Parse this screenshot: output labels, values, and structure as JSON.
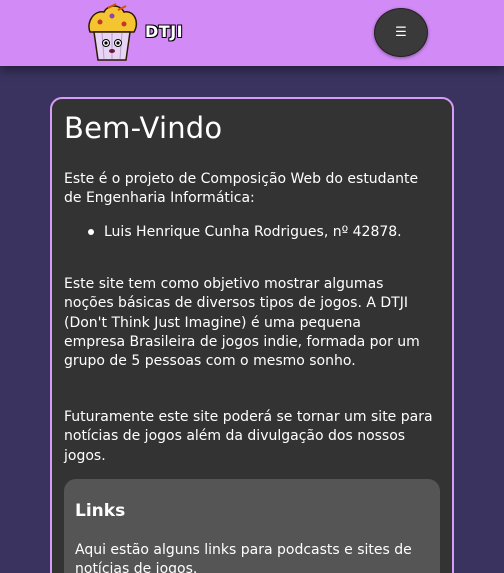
{
  "header": {
    "brand": "DTJI",
    "menu_icon": "☰"
  },
  "main": {
    "title": "Bem-Vindo",
    "intro": "Este é o projeto de Composição Web do estudante de Engenharia Informática:",
    "students": [
      "Luis Henrique Cunha Rodrigues, nº 42878."
    ],
    "about": "Este site tem como objetivo mostrar algumas noções básicas de diversos tipos de jogos. A DTJI (Don't Think Just Imagine) é uma pequena empresa Brasileira de jogos indie, formada por um grupo de 5 pessoas com o mesmo sonho.",
    "future": "Futuramente este site poderá se tornar um site para notícias de jogos além da divulgação dos nossos jogos."
  },
  "links": {
    "title": "Links",
    "text": "Aqui estão alguns links para podcasts e sites de notícias de jogos."
  },
  "colors": {
    "header": "#d28af6",
    "background": "#3a3360",
    "card": "#333333",
    "card_border": "#d79cf7",
    "links_box": "#555555"
  }
}
